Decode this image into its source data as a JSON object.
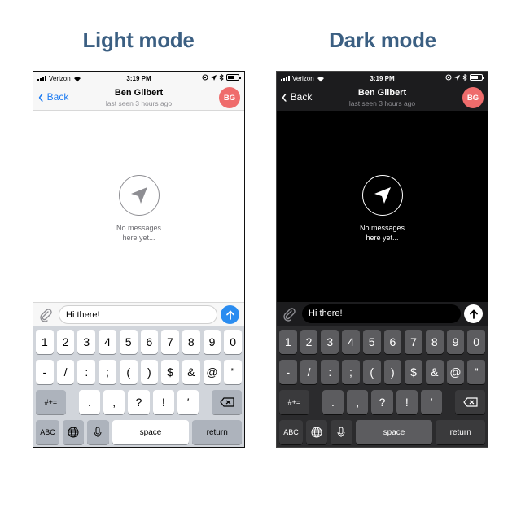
{
  "titles": {
    "light": "Light mode",
    "dark": "Dark mode"
  },
  "status": {
    "carrier": "Verizon",
    "time": "3:19 PM"
  },
  "nav": {
    "back": "Back",
    "contact_name": "Ben Gilbert",
    "last_seen": "last seen 3 hours ago",
    "avatar_initials": "BG"
  },
  "empty_state": {
    "line1": "No messages",
    "line2": "here yet..."
  },
  "composer": {
    "text": "Hi there!"
  },
  "keyboard": {
    "row1": [
      "1",
      "2",
      "3",
      "4",
      "5",
      "6",
      "7",
      "8",
      "9",
      "0"
    ],
    "row2": [
      "-",
      "/",
      ":",
      ";",
      "(",
      ")",
      "$",
      "&",
      "@",
      "”"
    ],
    "symbols_key": "#+=",
    "row3": [
      ".",
      ",",
      "?",
      "!",
      "′"
    ],
    "abc": "ABC",
    "space": "space",
    "return": "return"
  },
  "colors": {
    "title": "#3b5f82",
    "accent_blue": "#1e7cf2",
    "avatar": "#ef6c6c"
  },
  "icons": {
    "wifi": "wifi-icon",
    "location": "location-arrow-icon",
    "bluetooth": "bluetooth-icon",
    "battery": "battery-icon",
    "attachment": "paperclip-icon",
    "send": "send-arrow-icon",
    "plane": "paper-plane-icon",
    "globe": "globe-icon",
    "mic": "microphone-icon",
    "backspace": "backspace-icon"
  }
}
